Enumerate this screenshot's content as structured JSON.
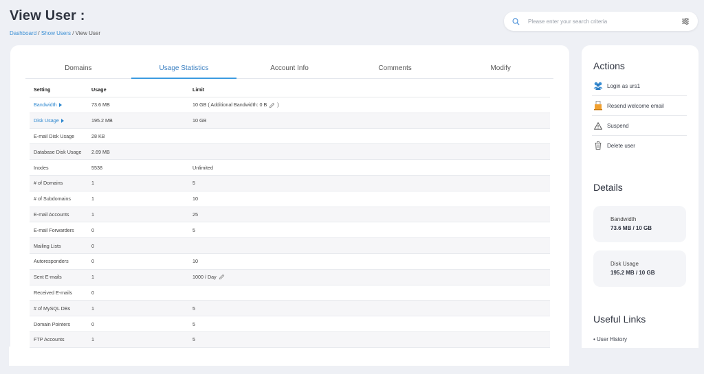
{
  "header": {
    "title": "View User :",
    "breadcrumb": [
      "Dashboard",
      "Show Users",
      "View User"
    ],
    "separator": "/"
  },
  "search": {
    "placeholder": "Please enter your search criteria"
  },
  "tabs": [
    {
      "label": "Domains",
      "active": false
    },
    {
      "label": "Usage Statistics",
      "active": true
    },
    {
      "label": "Account Info",
      "active": false
    },
    {
      "label": "Comments",
      "active": false
    },
    {
      "label": "Modify",
      "active": false
    }
  ],
  "table": {
    "headers": [
      "Setting",
      "Usage",
      "Limit"
    ],
    "rows": [
      {
        "setting": "Bandwidth",
        "usage": "73.6 MB",
        "limit": "10 GB ( Additional Bandwidth: 0 B",
        "limit_suffix": ")",
        "link": true,
        "editable": true
      },
      {
        "setting": "Disk Usage",
        "usage": "195.2 MB",
        "limit": "10 GB",
        "link": true
      },
      {
        "setting": "E-mail Disk Usage",
        "usage": "28 KB",
        "limit": ""
      },
      {
        "setting": "Database Disk Usage",
        "usage": "2.69 MB",
        "limit": ""
      },
      {
        "setting": "Inodes",
        "usage": "5538",
        "limit": "Unlimited"
      },
      {
        "setting": "# of Domains",
        "usage": "1",
        "limit": "5"
      },
      {
        "setting": "# of Subdomains",
        "usage": "1",
        "limit": "10"
      },
      {
        "setting": "E-mail Accounts",
        "usage": "1",
        "limit": "25"
      },
      {
        "setting": "E-mail Forwarders",
        "usage": "0",
        "limit": "5"
      },
      {
        "setting": "Mailing Lists",
        "usage": "0",
        "limit": ""
      },
      {
        "setting": "Autoresponders",
        "usage": "0",
        "limit": "10"
      },
      {
        "setting": "Sent E-mails",
        "usage": "1",
        "limit": "1000 / Day",
        "editable": true
      },
      {
        "setting": "Received E-mails",
        "usage": "0",
        "limit": ""
      },
      {
        "setting": "# of MySQL DBs",
        "usage": "1",
        "limit": "5"
      },
      {
        "setting": "Domain Pointers",
        "usage": "0",
        "limit": "5"
      },
      {
        "setting": "FTP Accounts",
        "usage": "1",
        "limit": "5"
      }
    ]
  },
  "sidebar": {
    "actions_title": "Actions",
    "actions": [
      {
        "label": "Login as urs1",
        "icon": "users-icon"
      },
      {
        "label": "Resend welcome email",
        "icon": "email-icon"
      },
      {
        "label": "Suspend",
        "icon": "warning-icon"
      },
      {
        "label": "Delete user",
        "icon": "trash-icon"
      }
    ],
    "details_title": "Details",
    "details": [
      {
        "label": "Bandwidth",
        "value": "73.6 MB / 10 GB"
      },
      {
        "label": "Disk Usage",
        "value": "195.2 MB / 10 GB"
      }
    ],
    "links_title": "Useful Links",
    "links": [
      "• User History"
    ]
  },
  "colors": {
    "accent": "#3b9be0",
    "link": "#2d87cf",
    "background": "#eef0f5"
  }
}
